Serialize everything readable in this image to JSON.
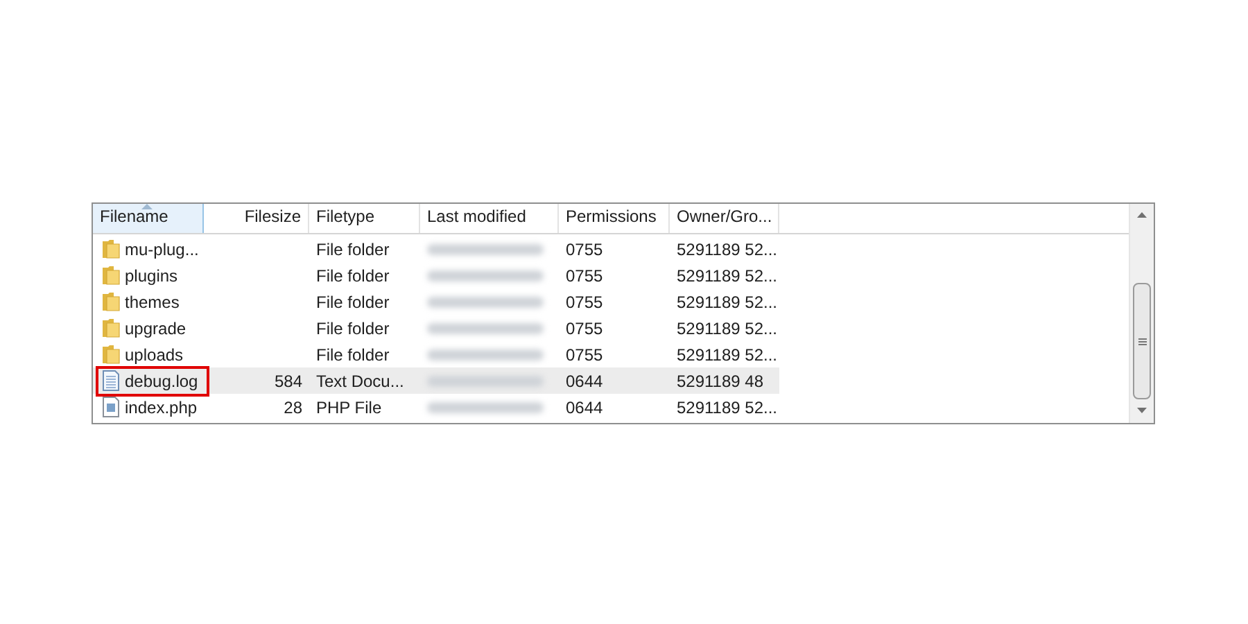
{
  "table": {
    "columns": [
      {
        "label": "Filename",
        "sorted": true
      },
      {
        "label": "Filesize",
        "sorted": false
      },
      {
        "label": "Filetype",
        "sorted": false
      },
      {
        "label": "Last modified",
        "sorted": false
      },
      {
        "label": "Permissions",
        "sorted": false
      },
      {
        "label": "Owner/Gro...",
        "sorted": false
      }
    ],
    "rows": [
      {
        "kind": "folder",
        "name": "mu-plug...",
        "type": "File folder",
        "permissions": "0755",
        "owner": "5291189 52...",
        "selected": false,
        "highlighted": false
      },
      {
        "kind": "folder",
        "name": "plugins",
        "type": "File folder",
        "permissions": "0755",
        "owner": "5291189 52...",
        "selected": false,
        "highlighted": false
      },
      {
        "kind": "folder",
        "name": "themes",
        "type": "File folder",
        "permissions": "0755",
        "owner": "5291189 52...",
        "selected": false,
        "highlighted": false
      },
      {
        "kind": "folder",
        "name": "upgrade",
        "type": "File folder",
        "permissions": "0755",
        "owner": "5291189 52...",
        "selected": false,
        "highlighted": false
      },
      {
        "kind": "folder",
        "name": "uploads",
        "type": "File folder",
        "permissions": "0755",
        "owner": "5291189 52...",
        "selected": false,
        "highlighted": false
      },
      {
        "kind": "text",
        "name": "debug.log",
        "size": "584",
        "type": "Text Docu...",
        "permissions": "0644",
        "owner": "5291189 48",
        "selected": true,
        "highlighted": true
      },
      {
        "kind": "php",
        "name": "index.php",
        "size": "28",
        "type": "PHP File",
        "permissions": "0644",
        "owner": "5291189 52...",
        "selected": false,
        "highlighted": false
      }
    ]
  }
}
